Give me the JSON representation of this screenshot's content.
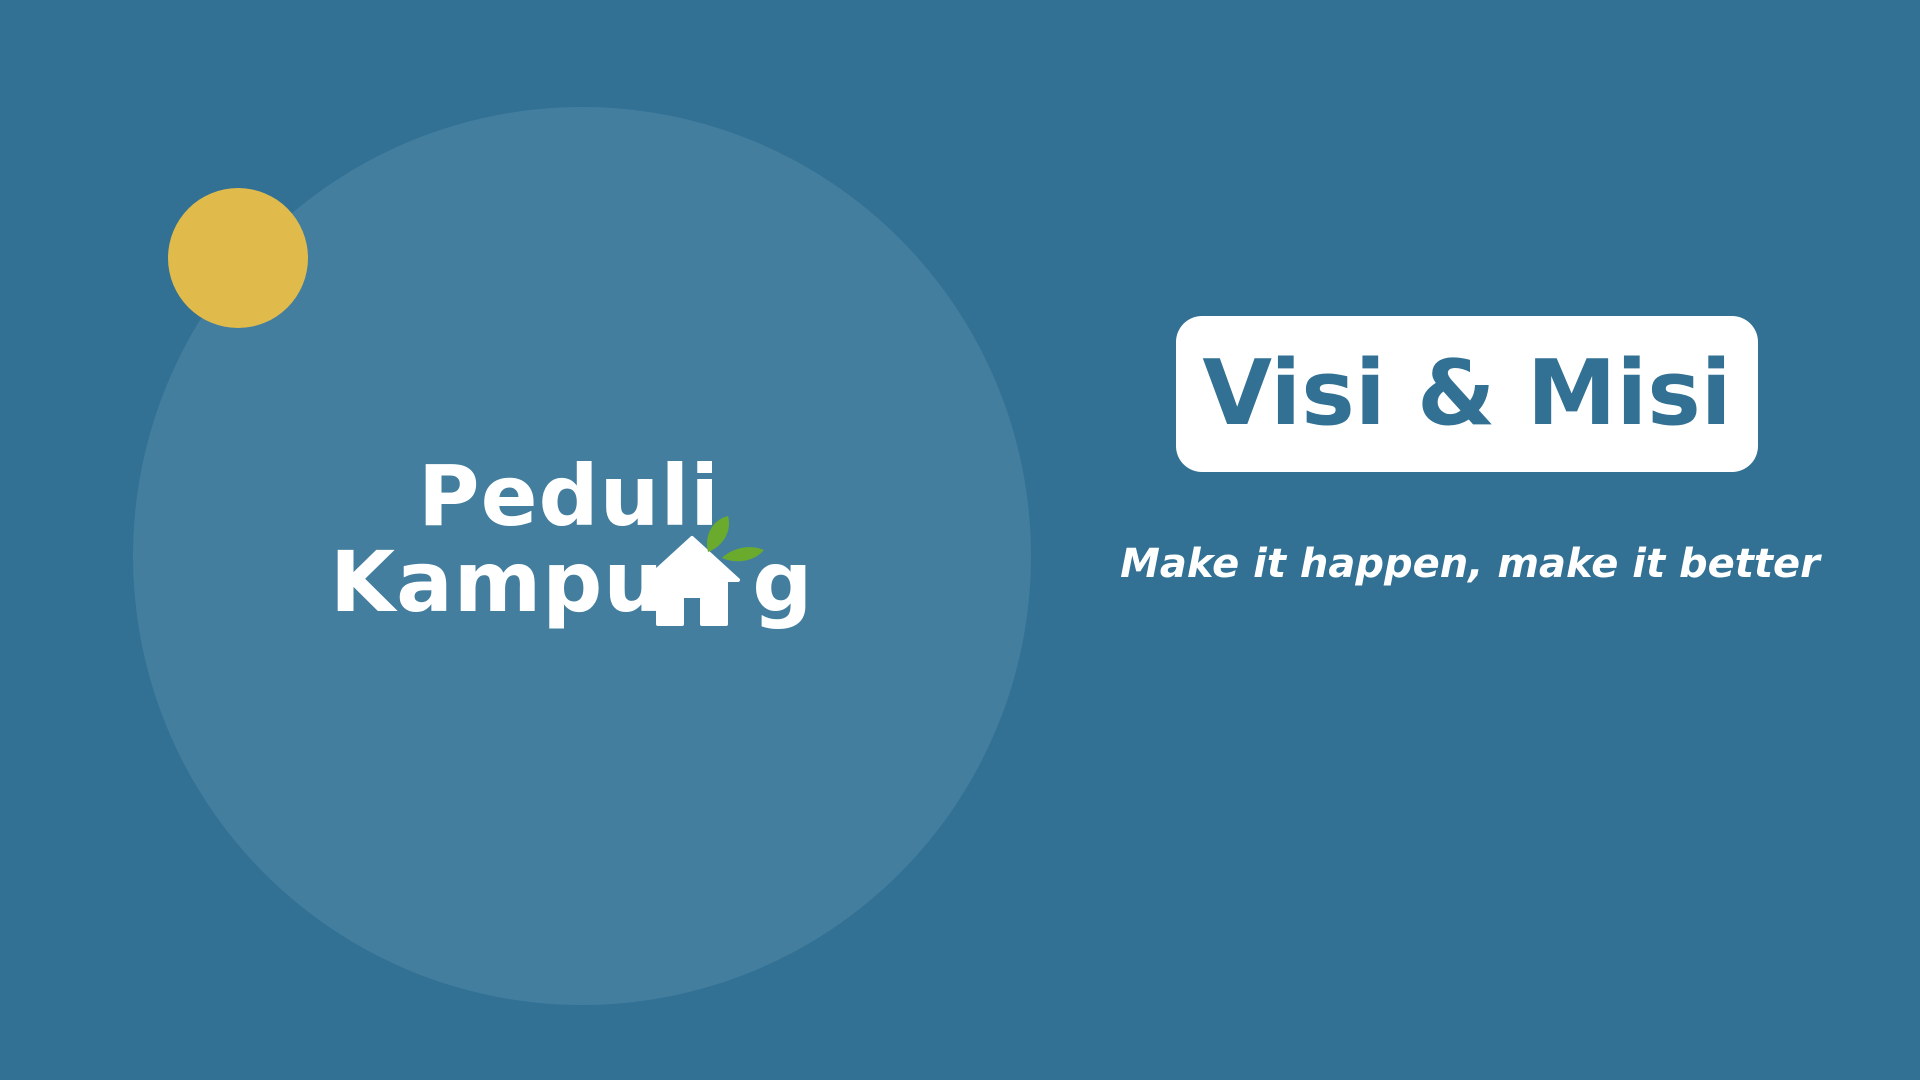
{
  "colors": {
    "background": "#327194",
    "circle": "#437e9f",
    "accent_yellow": "#e0bb4c",
    "title_text": "#327194",
    "leaf_green": "#6aab2e"
  },
  "logo": {
    "line1": "Peduli",
    "line2_left": "Kampu",
    "line2_right": "g",
    "icons": [
      "house-icon",
      "leaf-icon"
    ]
  },
  "title": "Visi & Misi",
  "tagline": "Make it happen, make it better"
}
